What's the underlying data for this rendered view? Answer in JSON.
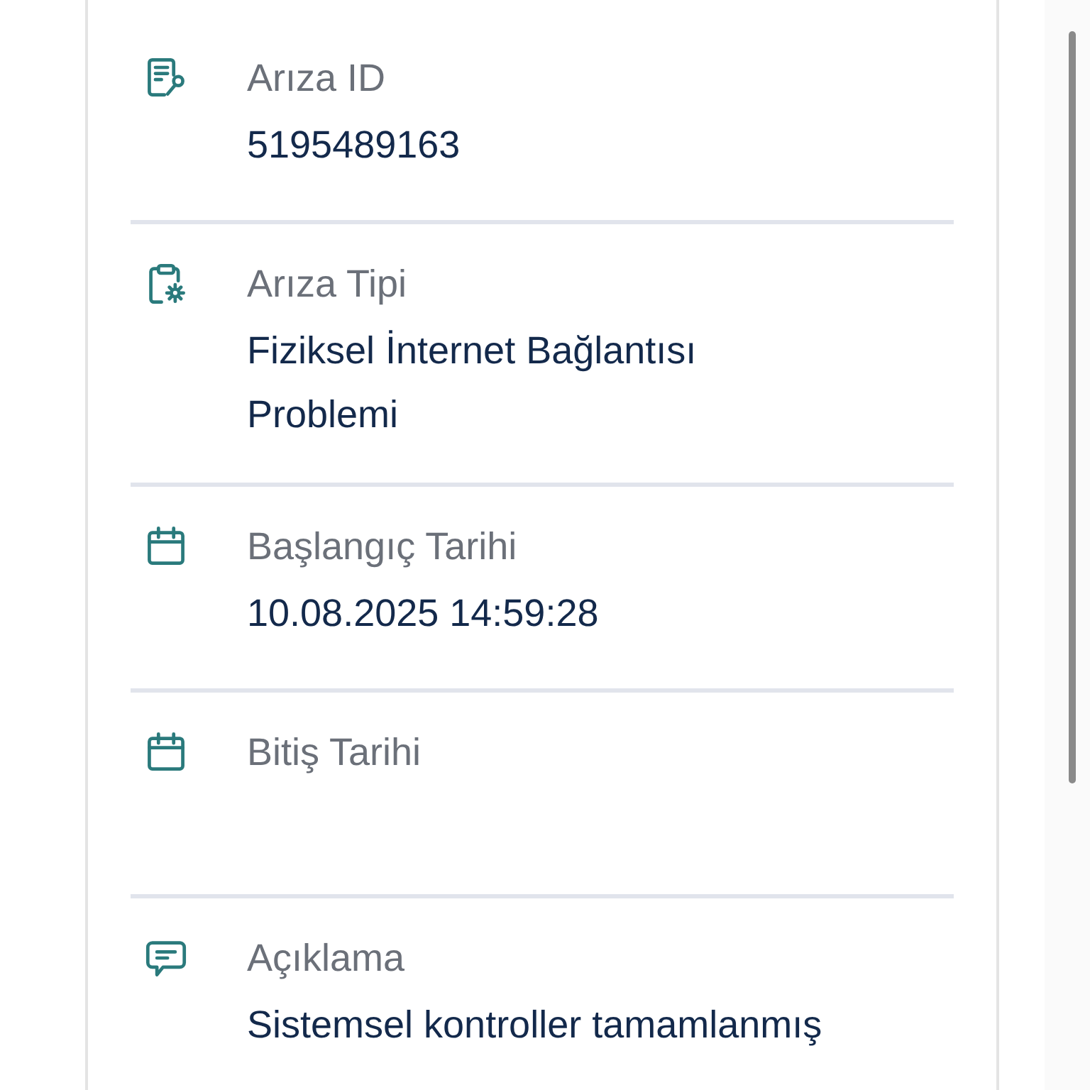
{
  "details": [
    {
      "kind": "document-key",
      "label": "Arıza ID",
      "value": [
        "5195489163"
      ]
    },
    {
      "kind": "clipboard-gear",
      "label": "Arıza Tipi",
      "value": [
        "Fiziksel İnternet Bağlantısı",
        "Problemi"
      ]
    },
    {
      "kind": "calendar",
      "label": "Başlangıç Tarihi",
      "value": [
        "10.08.2025 14:59:28"
      ]
    },
    {
      "kind": "calendar",
      "label": "Bitiş Tarihi"
    },
    {
      "kind": "chat",
      "label": "Açıklama",
      "value": [
        "Sistemsel kontroller tamamlanmış"
      ]
    }
  ]
}
